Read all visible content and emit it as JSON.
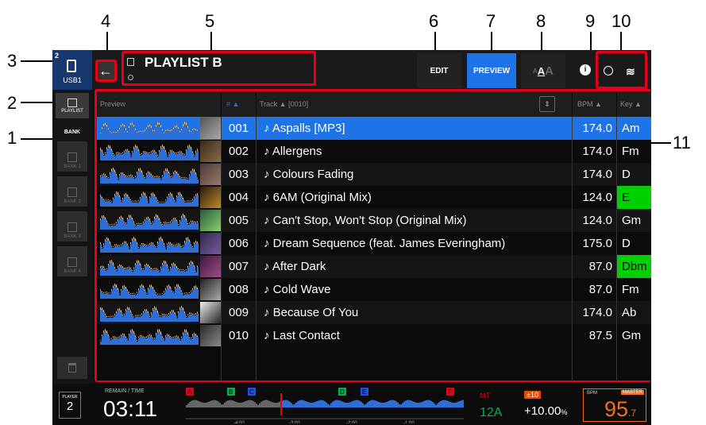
{
  "callouts": [
    "1",
    "2",
    "3",
    "4",
    "5",
    "6",
    "7",
    "8",
    "9",
    "10",
    "11"
  ],
  "usb": {
    "badge": "2",
    "label": "USB1"
  },
  "header": {
    "title": "PLAYLIST B",
    "edit_label": "EDIT",
    "preview_label": "PREVIEW",
    "info_icon": "info-icon",
    "globe_icon": "globe-icon",
    "wifi_icon": "wifi-icon"
  },
  "sidebar": {
    "playlist_label": "PLAYLIST",
    "bank_label": "BANK",
    "banks": [
      "BANK 1",
      "BANK 2",
      "BANK 3",
      "BANK 4"
    ]
  },
  "table": {
    "col_preview": "Preview",
    "col_num": "# ▲",
    "col_track": "Track ▲   [0010]",
    "col_bpm": "BPM ▲",
    "col_key": "Key ▲",
    "rows": [
      {
        "num": "001",
        "track": "♪ Aspalls [MP3]",
        "bpm": "174.0",
        "key": "Am",
        "selected": true,
        "key_hl": false
      },
      {
        "num": "002",
        "track": "♪ Allergens",
        "bpm": "174.0",
        "key": "Fm",
        "selected": false,
        "key_hl": false
      },
      {
        "num": "003",
        "track": "♪ Colours Fading",
        "bpm": "174.0",
        "key": "D",
        "selected": false,
        "key_hl": false
      },
      {
        "num": "004",
        "track": "♪ 6AM (Original Mix)",
        "bpm": "124.0",
        "key": "E",
        "selected": false,
        "key_hl": true
      },
      {
        "num": "005",
        "track": "♪ Can't Stop, Won't Stop (Original Mix)",
        "bpm": "124.0",
        "key": "Gm",
        "selected": false,
        "key_hl": false
      },
      {
        "num": "006",
        "track": "♪ Dream Sequence (feat. James Everingham)",
        "bpm": "175.0",
        "key": "D",
        "selected": false,
        "key_hl": false
      },
      {
        "num": "007",
        "track": "♪ After Dark",
        "bpm": "87.0",
        "key": "Dbm",
        "selected": false,
        "key_hl": true
      },
      {
        "num": "008",
        "track": "♪ Cold Wave",
        "bpm": "87.0",
        "key": "Fm",
        "selected": false,
        "key_hl": false
      },
      {
        "num": "009",
        "track": "♪ Because Of You",
        "bpm": "174.0",
        "key": "Ab",
        "selected": false,
        "key_hl": false
      },
      {
        "num": "010",
        "track": "♪  Last Contact",
        "bpm": "87.5",
        "key": "Gm",
        "selected": false,
        "key_hl": false
      }
    ]
  },
  "player": {
    "player_label": "PLAYER",
    "player_num": "2",
    "remain_label": "REMAIN / TIME",
    "time": "03:11",
    "cue_labels": [
      "A",
      "B",
      "C",
      "D",
      "E",
      "F"
    ],
    "mt": "MT",
    "key": "12A",
    "tempo_range": "±10",
    "tempo": "+10.00",
    "tempo_unit": "%",
    "bpm_label": "BPM",
    "master_label": "MASTER",
    "bpm_int": "95",
    "bpm_dec": ".7",
    "markers": [
      "-4:00",
      "-3:00",
      "-2:00",
      "-1:00"
    ]
  },
  "colors": {
    "accent": "#1e74e6",
    "callout": "#e3001b",
    "key_hl": "#00d000",
    "bpm_orange": "#f07020"
  }
}
